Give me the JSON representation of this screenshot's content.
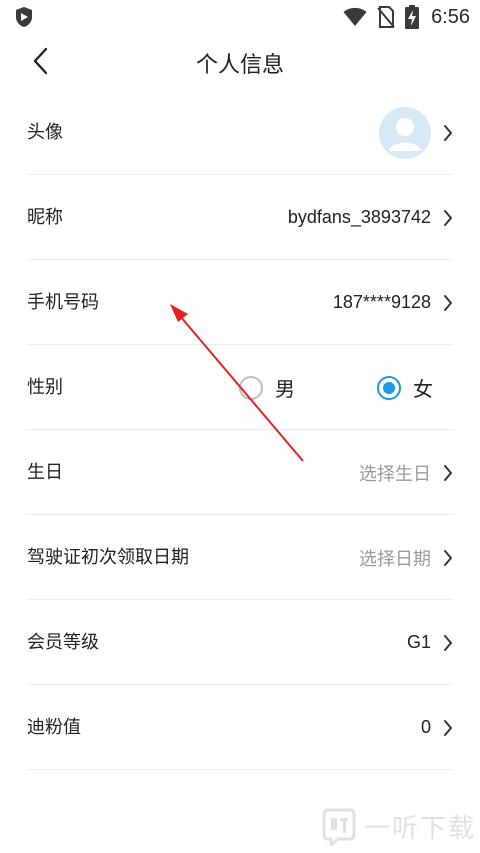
{
  "status_bar": {
    "time": "6:56",
    "icons": [
      "shield-icon",
      "wifi-icon",
      "no-sim-icon",
      "battery-charging-icon"
    ]
  },
  "header": {
    "title": "个人信息",
    "back_icon": "chevron-left-icon"
  },
  "rows": {
    "avatar": {
      "label": "头像"
    },
    "nickname": {
      "label": "昵称",
      "value": "bydfans_3893742"
    },
    "phone": {
      "label": "手机号码",
      "value": "187****9128"
    },
    "gender": {
      "label": "性别",
      "options": [
        {
          "label": "男",
          "checked": false
        },
        {
          "label": "女",
          "checked": true
        }
      ]
    },
    "birthday": {
      "label": "生日",
      "value": "选择生日"
    },
    "license_date": {
      "label": "驾驶证初次领取日期",
      "value": "选择日期"
    },
    "member_level": {
      "label": "会员等级",
      "value": "G1"
    },
    "points": {
      "label": "迪粉值",
      "value": "0"
    }
  },
  "colors": {
    "accent": "#1b9ae0",
    "annotation_arrow": "#e52222",
    "divider": "#ececec",
    "placeholder": "#9a9a9a"
  },
  "watermark": {
    "text": "一听下载"
  }
}
